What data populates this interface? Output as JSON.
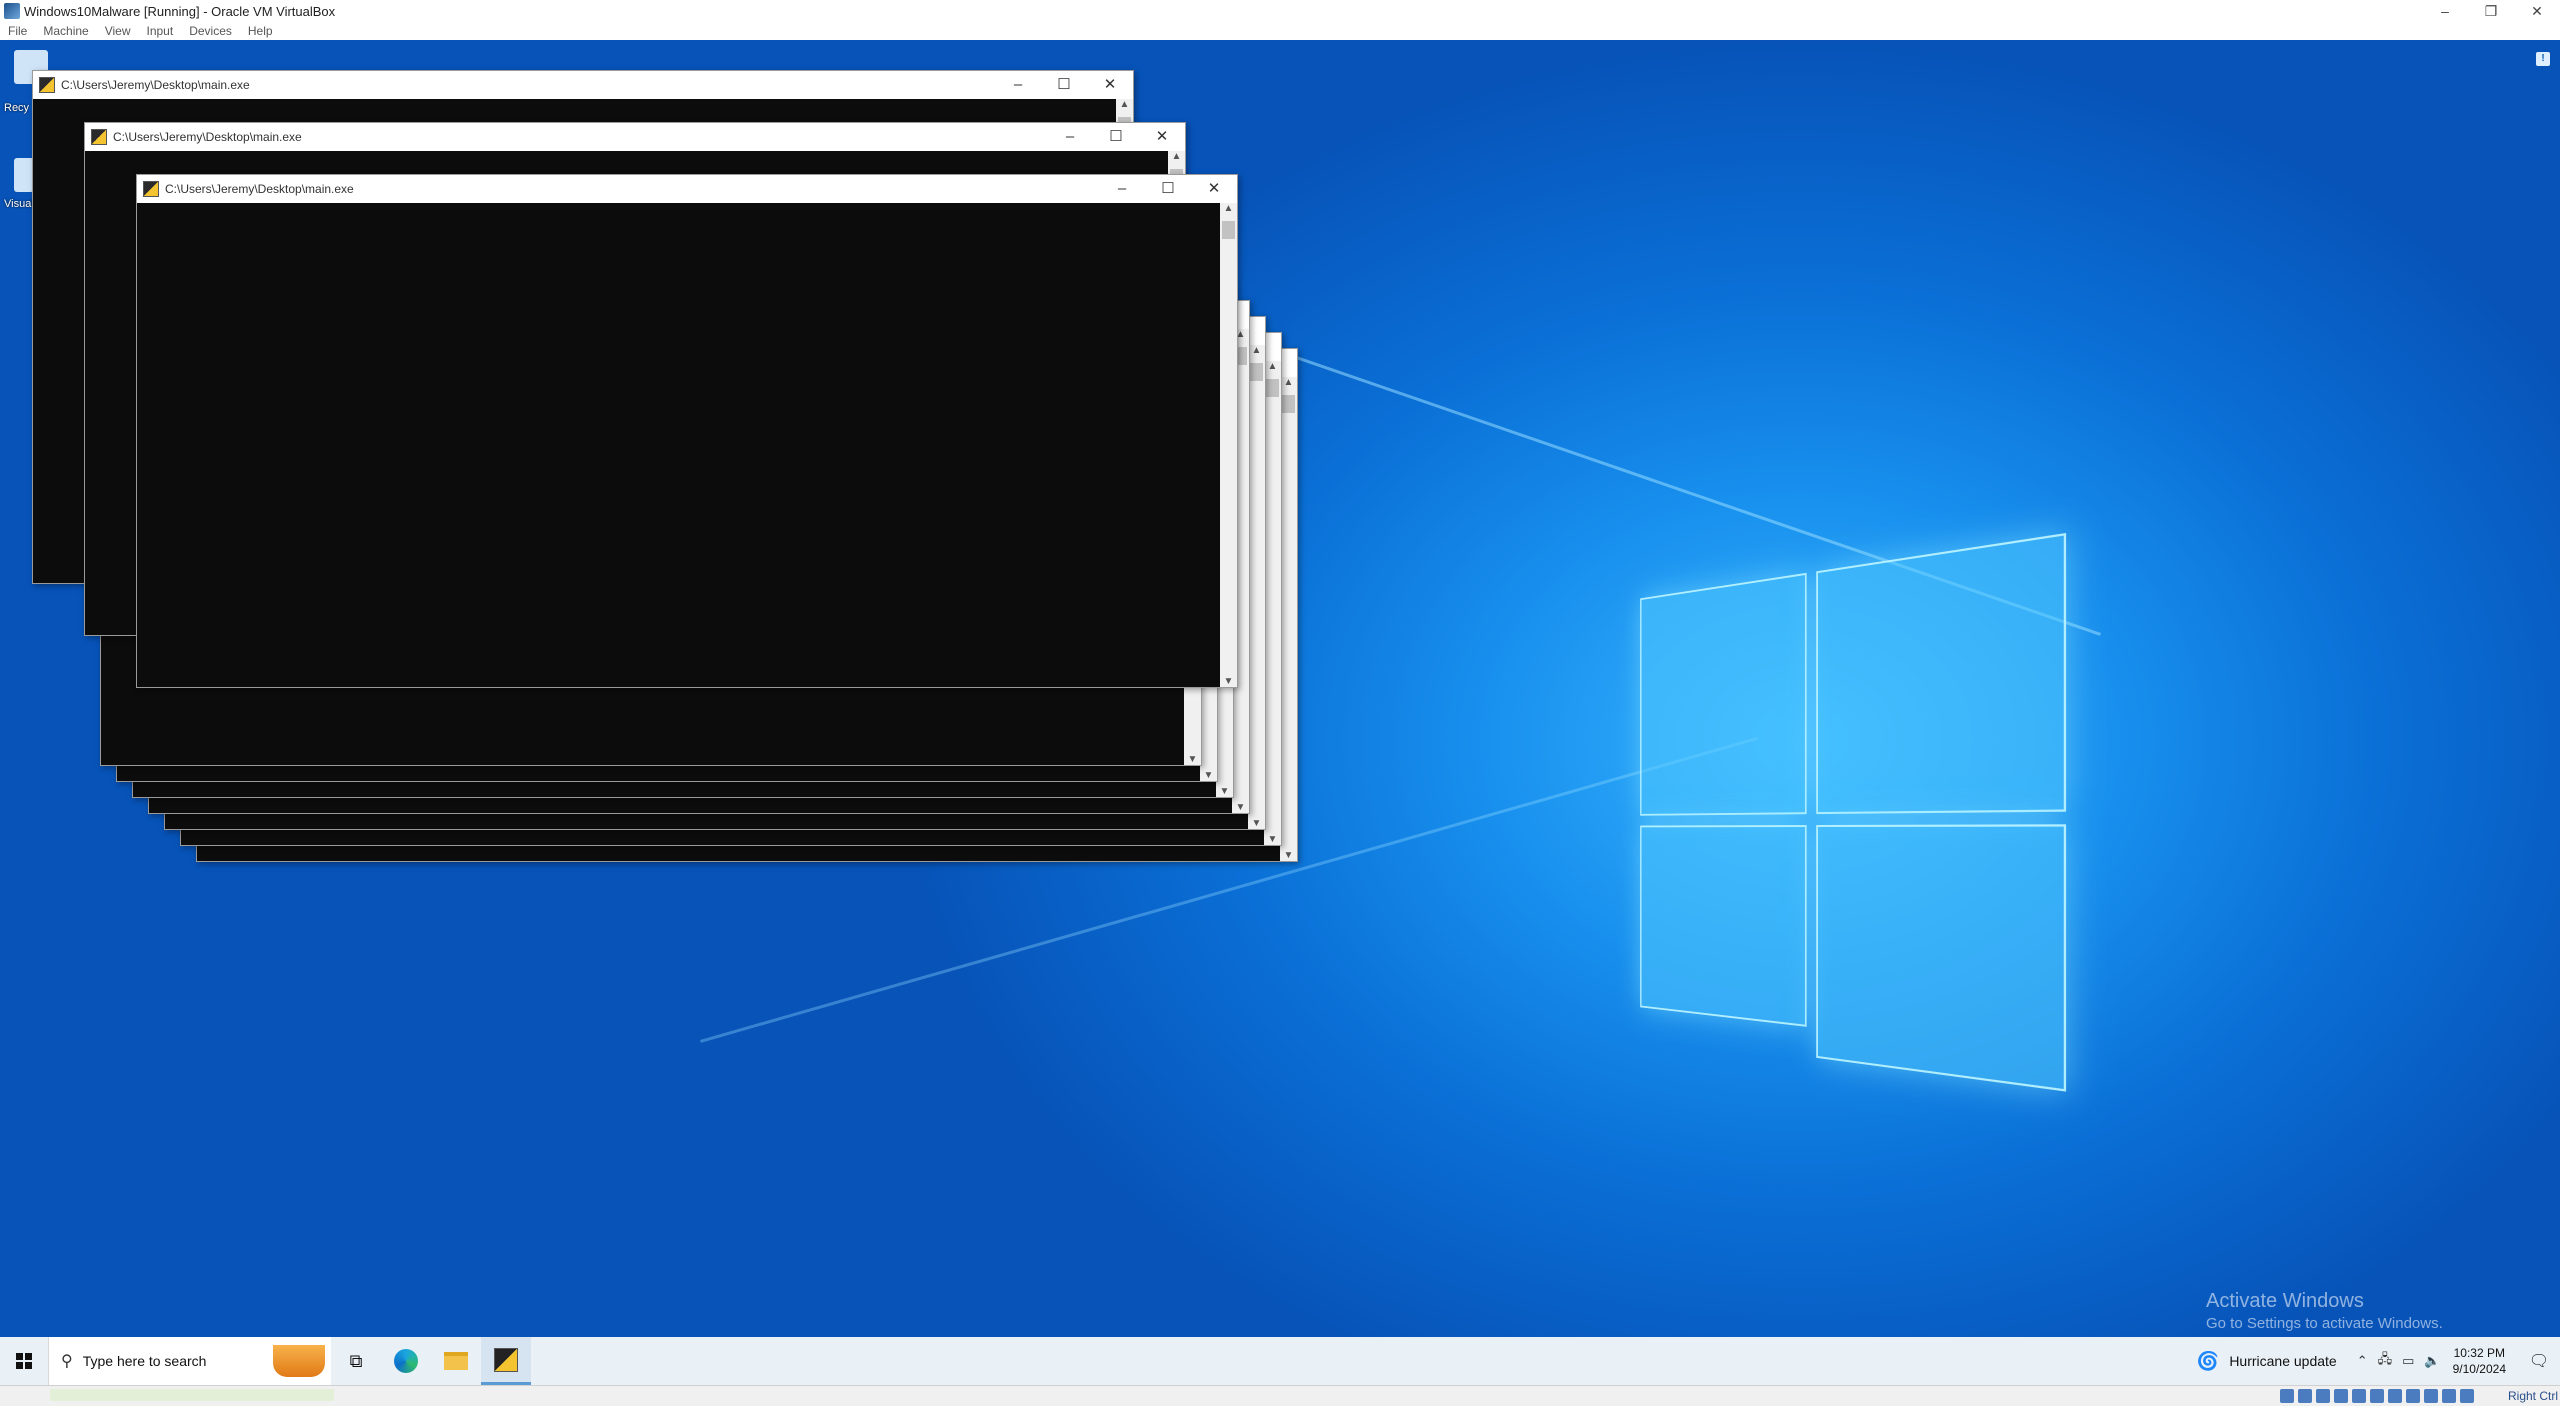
{
  "host_window": {
    "title": "Windows10Malware [Running] - Oracle VM VirtualBox",
    "controls": {
      "minimize": "–",
      "restore": "❐",
      "close": "✕"
    },
    "menu": [
      "File",
      "Machine",
      "View",
      "Input",
      "Devices",
      "Help"
    ]
  },
  "desktop": {
    "icons": [
      {
        "label": "Recy"
      },
      {
        "label": "Visual"
      }
    ],
    "watermark": {
      "line1": "Activate Windows",
      "line2": "Go to Settings to activate Windows."
    }
  },
  "console_windows": [
    {
      "title": ""
    },
    {
      "title": ""
    },
    {
      "title": ""
    },
    {
      "title": ""
    },
    {
      "title": ""
    },
    {
      "title": ""
    },
    {
      "title": ""
    },
    {
      "title": "C:\\Users\\Jeremy\\Desktop\\main.exe"
    },
    {
      "title": "C:\\Users\\Jeremy\\Desktop\\main.exe"
    },
    {
      "title": "C:\\Users\\Jeremy\\Desktop\\main.exe"
    }
  ],
  "window_controls": {
    "minimize": "–",
    "maximize": "☐",
    "close": "✕"
  },
  "taskbar": {
    "search_placeholder": "Type here to search",
    "news": "Hurricane update",
    "time": "10:32 PM",
    "date": "9/10/2024"
  },
  "vbox_status": {
    "host_key": "Right Ctrl"
  },
  "colors": {
    "console_bg": "#0c0c0c",
    "desktop_blue": "#0a6fd6",
    "taskbar_bg": "#e9f0f6"
  }
}
